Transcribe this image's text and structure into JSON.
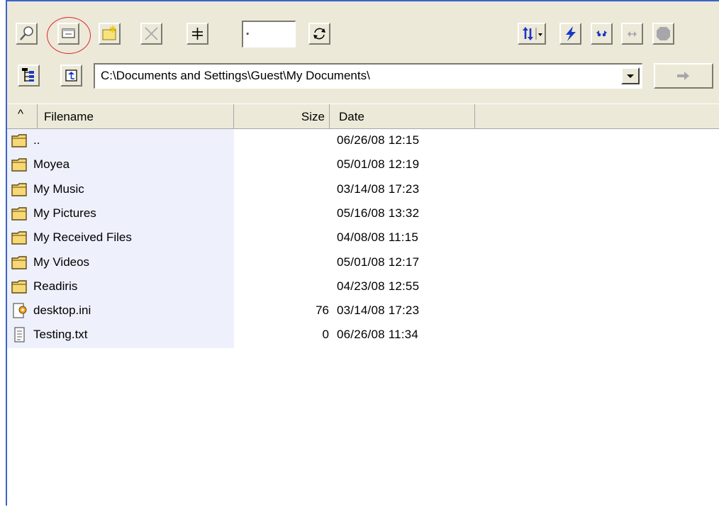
{
  "toolbar": {
    "filter_value": "*",
    "buttons": [
      {
        "id": "find",
        "icon": "magnifier-icon"
      },
      {
        "id": "view",
        "icon": "window-view-icon"
      },
      {
        "id": "new-folder",
        "icon": "new-folder-sparkle-icon"
      },
      {
        "id": "delete",
        "icon": "delete-x-icon"
      },
      {
        "id": "split",
        "icon": "split-bars-icon"
      },
      {
        "id": "refresh",
        "icon": "refresh-icon"
      },
      {
        "id": "sort",
        "icon": "sort-arrows-icon"
      },
      {
        "id": "connect",
        "icon": "lightning-icon"
      },
      {
        "id": "sync",
        "icon": "sync-dots-icon"
      },
      {
        "id": "compare",
        "icon": "compare-arrows-icon"
      },
      {
        "id": "stop",
        "icon": "stop-octagon-icon"
      }
    ]
  },
  "pathbar": {
    "path": "C:\\Documents and Settings\\Guest\\My Documents\\"
  },
  "columns": {
    "sort_indicator": "^",
    "filename": "Filename",
    "size": "Size",
    "date": "Date"
  },
  "colors": {
    "chrome": "#ece9d8",
    "accent_border": "#3b63c8",
    "selection_band": "#eef0fb",
    "highlight_ring": "#e0242b",
    "folder_yellow": "#f8d775"
  },
  "files": [
    {
      "name": "..",
      "size": "",
      "date": "06/26/08  12:15",
      "type": "folder"
    },
    {
      "name": "Moyea",
      "size": "",
      "date": "05/01/08  12:19",
      "type": "folder"
    },
    {
      "name": "My Music",
      "size": "",
      "date": "03/14/08  17:23",
      "type": "folder"
    },
    {
      "name": "My Pictures",
      "size": "",
      "date": "05/16/08  13:32",
      "type": "folder"
    },
    {
      "name": "My Received Files",
      "size": "",
      "date": "04/08/08  11:15",
      "type": "folder"
    },
    {
      "name": "My Videos",
      "size": "",
      "date": "05/01/08  12:17",
      "type": "folder"
    },
    {
      "name": "Readiris",
      "size": "",
      "date": "04/23/08  12:55",
      "type": "folder"
    },
    {
      "name": "desktop.ini",
      "size": "76",
      "date": "03/14/08  17:23",
      "type": "ini"
    },
    {
      "name": "Testing.txt",
      "size": "0",
      "date": "06/26/08  11:34",
      "type": "txt"
    }
  ]
}
